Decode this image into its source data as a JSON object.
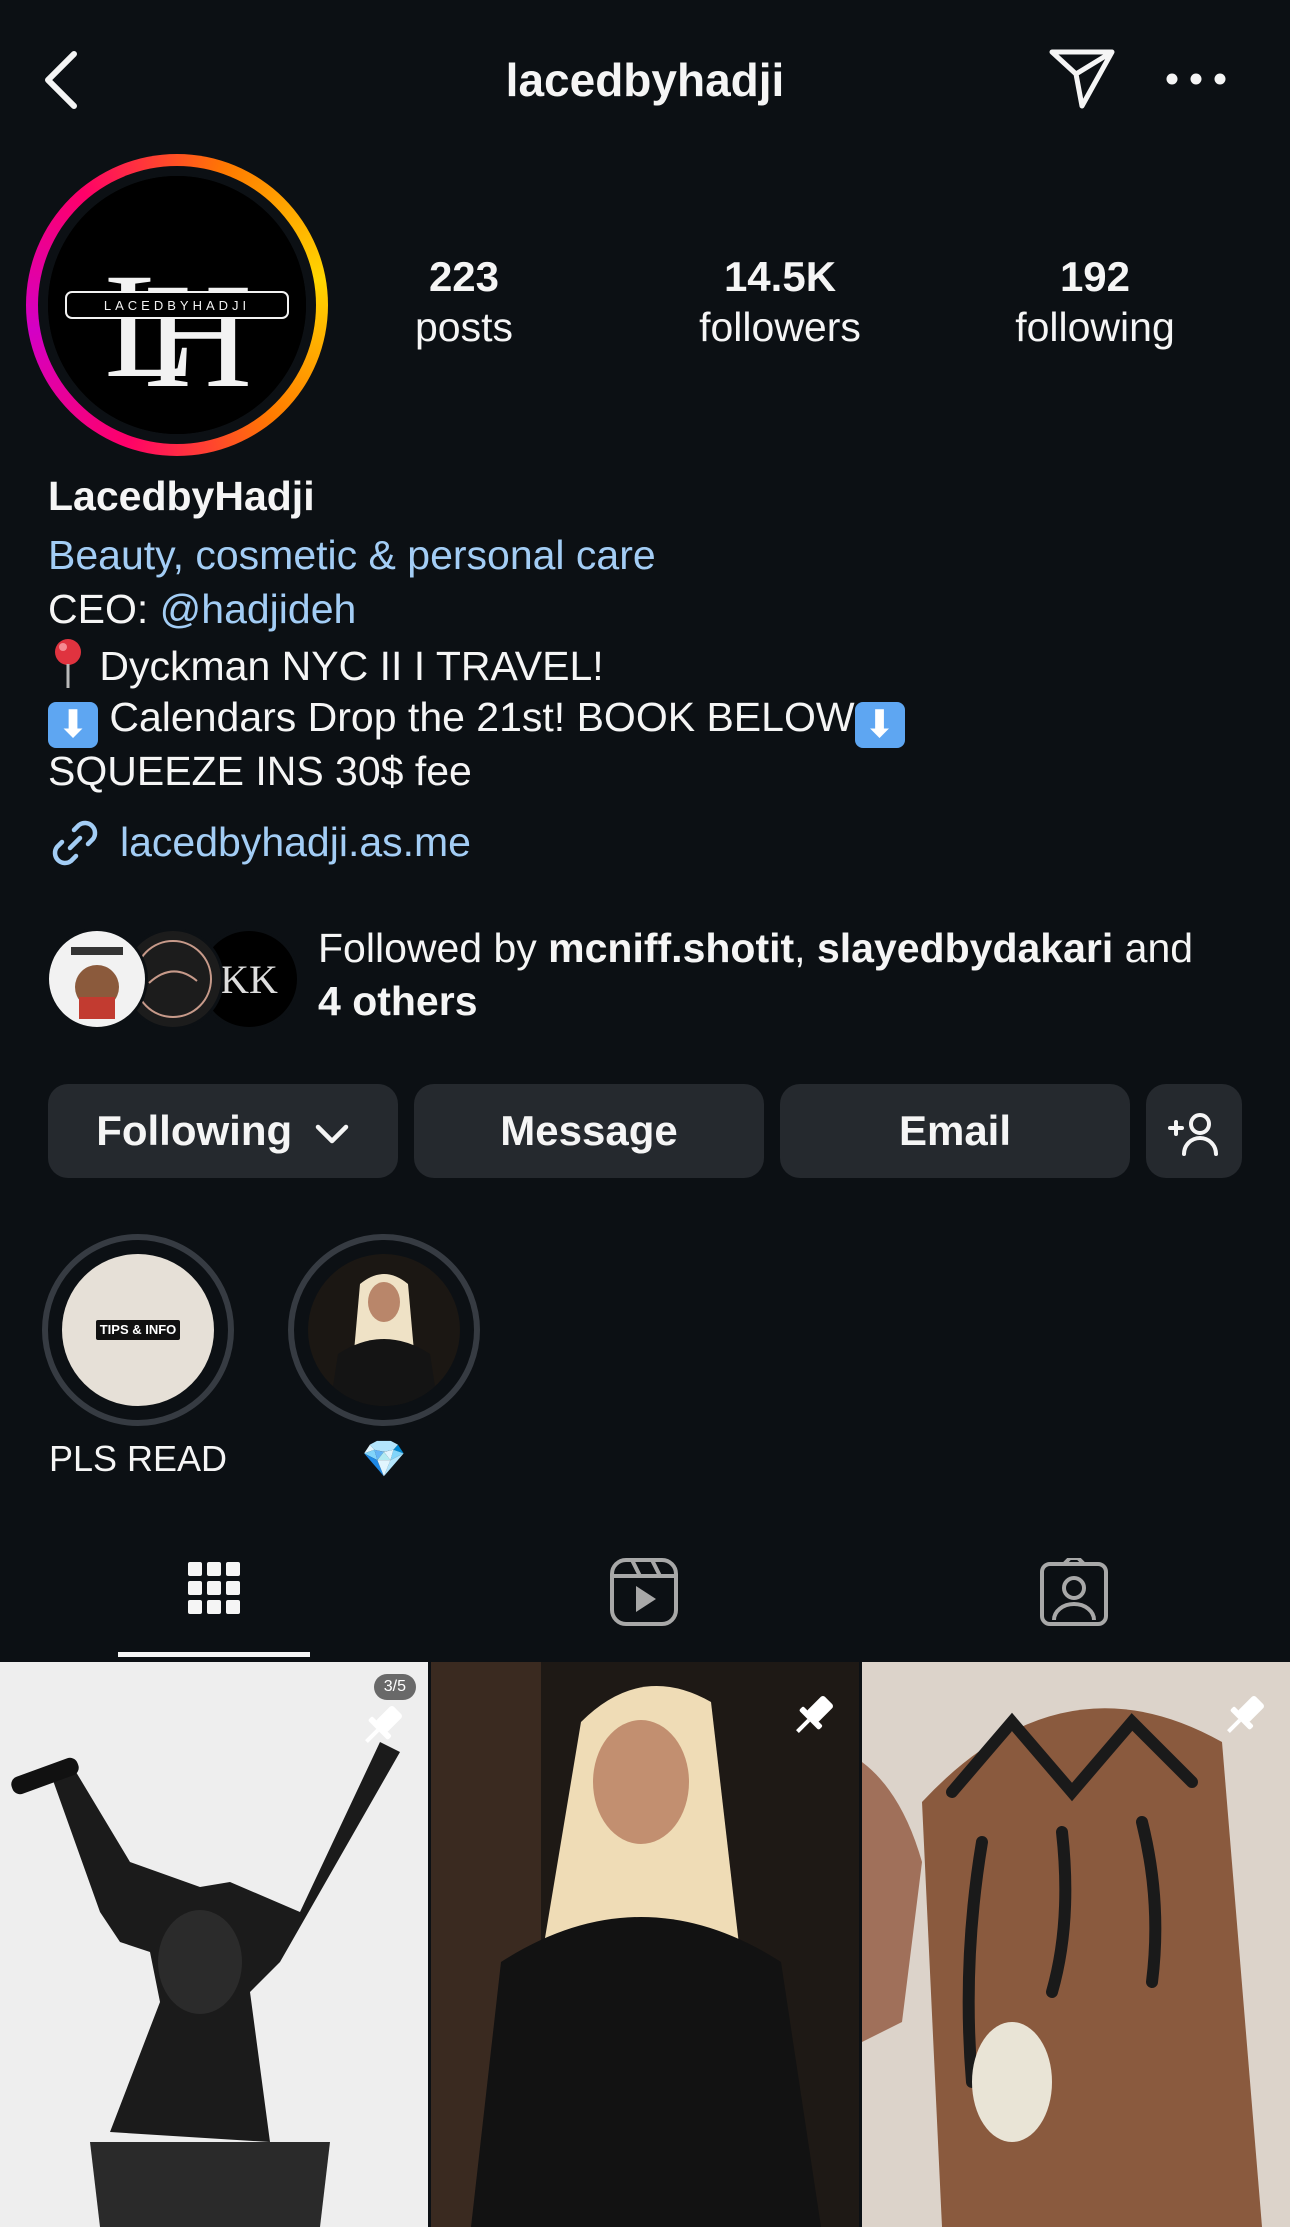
{
  "header": {
    "username": "lacedbyhadji",
    "back_icon": "chevron-left-icon",
    "send_icon": "paper-plane-icon",
    "more_icon": "more-horizontal-icon"
  },
  "profile": {
    "avatar_text": "LACEDBYHADJI",
    "stats": {
      "posts_count": "223",
      "posts_label": "posts",
      "followers_count": "14.5K",
      "followers_label": "followers",
      "following_count": "192",
      "following_label": "following"
    },
    "display_name": "LacedbyHadji",
    "category": "Beauty, cosmetic & personal care",
    "bio": {
      "line1_prefix": "CEO: ",
      "line1_mention": "@hadjideh",
      "line2_text": " Dyckman NYC II I TRAVEL!",
      "line3_text": " Calendars Drop the 21st! BOOK BELOW",
      "line4_text": "SQUEEZE INS 30$ fee",
      "arrow_emoji": "⬇"
    },
    "link": "lacedbyhadji.as.me",
    "followed_by": {
      "prefix": "Followed by ",
      "user1": "mcniff.shotit",
      "separator": ", ",
      "user2": "slayedbydakari",
      "and": " and",
      "others": "4 others"
    }
  },
  "actions": {
    "following_label": "Following",
    "message_label": "Message",
    "email_label": "Email"
  },
  "highlights": [
    {
      "label": "PLS READ",
      "cover_text": "TIPS & INFO"
    },
    {
      "label": "💎"
    }
  ],
  "posts": [
    {
      "badge": "3/5",
      "pinned": true
    },
    {
      "pinned": true
    },
    {
      "pinned": true
    }
  ],
  "colors": {
    "background": "#0c1014",
    "link": "#a3cdf5",
    "button": "#25292e"
  }
}
